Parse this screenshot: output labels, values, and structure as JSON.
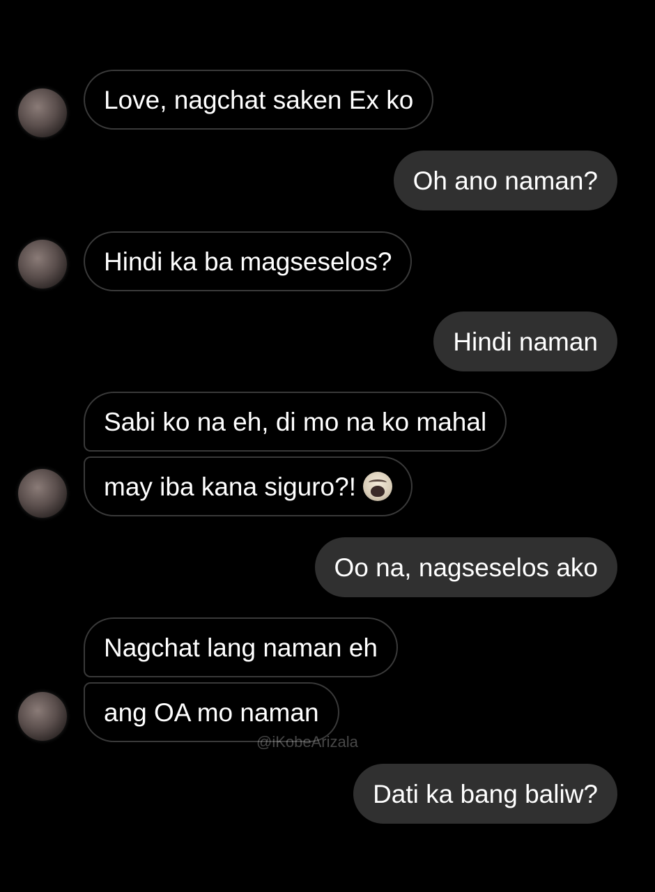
{
  "messages": [
    {
      "side": "incoming",
      "text": "Love, nagchat saken Ex ko"
    },
    {
      "side": "outgoing",
      "text": "Oh ano naman?"
    },
    {
      "side": "incoming",
      "text": "Hindi ka ba magseselos?"
    },
    {
      "side": "outgoing",
      "text": "Hindi naman"
    },
    {
      "side": "incoming",
      "text": "Sabi ko na eh, di mo na ko mahal"
    },
    {
      "side": "incoming",
      "text": "may iba kana siguro?!",
      "emoji": "crying-face"
    },
    {
      "side": "outgoing",
      "text": "Oo na, nagseselos ako"
    },
    {
      "side": "incoming",
      "text": "Nagchat lang naman eh"
    },
    {
      "side": "incoming",
      "text": "ang OA mo naman"
    },
    {
      "side": "outgoing",
      "text": "Dati ka bang baliw?"
    }
  ],
  "watermark": "@iKobeArizala",
  "colors": {
    "background": "#000000",
    "outgoing_bubble": "#303030",
    "incoming_border": "#3a3a3a",
    "text": "#ffffff"
  }
}
